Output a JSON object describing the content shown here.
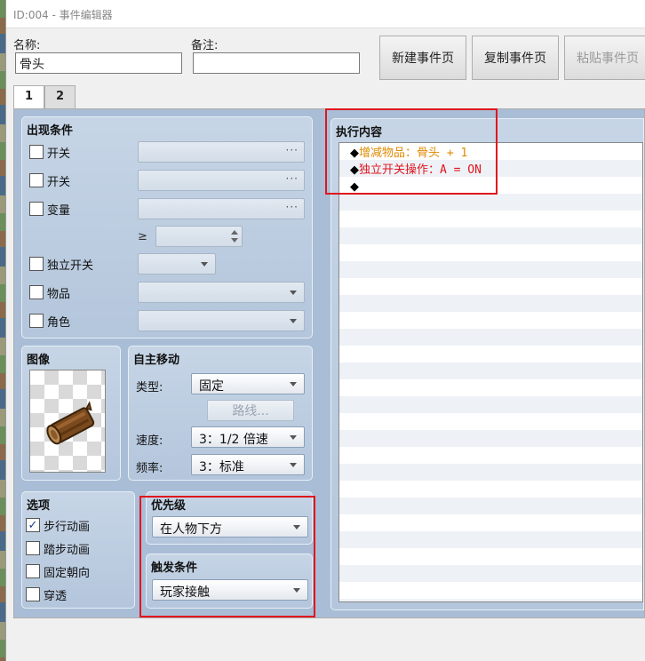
{
  "window": {
    "title": "ID:004 - 事件编辑器"
  },
  "top": {
    "name_label": "名称:",
    "name_value": "骨头",
    "note_label": "备注:",
    "note_value": "",
    "buttons": {
      "new_page": "新建事件页",
      "copy_page": "复制事件页",
      "paste_page": "粘贴事件页"
    }
  },
  "tabs": [
    {
      "label": "1"
    },
    {
      "label": "2"
    }
  ],
  "conditions": {
    "title": "出现条件",
    "switch1": {
      "label": "开关",
      "checked": false
    },
    "switch2": {
      "label": "开关",
      "checked": false
    },
    "variable": {
      "label": "变量",
      "checked": false
    },
    "gte_symbol": "≥",
    "self_switch": {
      "label": "独立开关",
      "checked": false
    },
    "item": {
      "label": "物品",
      "checked": false
    },
    "actor": {
      "label": "角色",
      "checked": false
    },
    "dots": "···"
  },
  "image": {
    "title": "图像"
  },
  "autonomous": {
    "title": "自主移动",
    "type_label": "类型:",
    "type_value": "固定",
    "route_button": "路线...",
    "speed_label": "速度:",
    "speed_value": "3：1/2 倍速",
    "freq_label": "频率:",
    "freq_value": "3：标准"
  },
  "options": {
    "title": "选项",
    "walking_anim": {
      "label": "步行动画",
      "checked": true
    },
    "stepping_anim": {
      "label": "踏步动画",
      "checked": false
    },
    "direction_fix": {
      "label": "固定朝向",
      "checked": false
    },
    "through": {
      "label": "穿透",
      "checked": false
    },
    "check_mark": "✓"
  },
  "priority": {
    "title": "优先级",
    "value": "在人物下方"
  },
  "trigger": {
    "title": "触发条件",
    "value": "玩家接触"
  },
  "contents": {
    "title": "执行内容",
    "diamond": "◆",
    "commands": [
      {
        "text": "增减物品：骨头 + 1",
        "color": "#e08a00"
      },
      {
        "text": "独立开关操作：A = ON",
        "color": "#e0161e"
      },
      {
        "text": "",
        "color": "#000000"
      }
    ]
  }
}
